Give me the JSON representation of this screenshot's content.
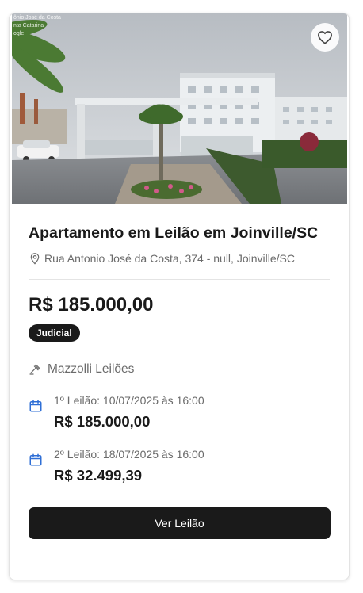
{
  "listing": {
    "photo_overlay": [
      "ônio José da Costa",
      "nta Catarina",
      "ogle"
    ],
    "favorite_icon": "heart-outline-icon",
    "title": "Apartamento em Leilão em Joinville/SC",
    "address_icon": "map-pin-icon",
    "address": "Rua Antonio José da Costa, 374 - null, Joinville/SC",
    "price": "R$ 185.000,00",
    "badge": "Judicial",
    "auctioneer_icon": "gavel-icon",
    "auctioneer": "Mazzolli Leilões",
    "rounds": [
      {
        "icon": "calendar-icon",
        "label": "1º Leilão: 10/07/2025 às 16:00",
        "value": "R$ 185.000,00"
      },
      {
        "icon": "calendar-icon",
        "label": "2º Leilão: 18/07/2025 às 16:00",
        "value": "R$ 32.499,39"
      }
    ],
    "cta_label": "Ver Leilão"
  },
  "colors": {
    "text_dark": "#1a1a1a",
    "text_muted": "#6b6b6b",
    "calendar_accent": "#2f6fd6",
    "button_bg": "#1a1a1a"
  }
}
